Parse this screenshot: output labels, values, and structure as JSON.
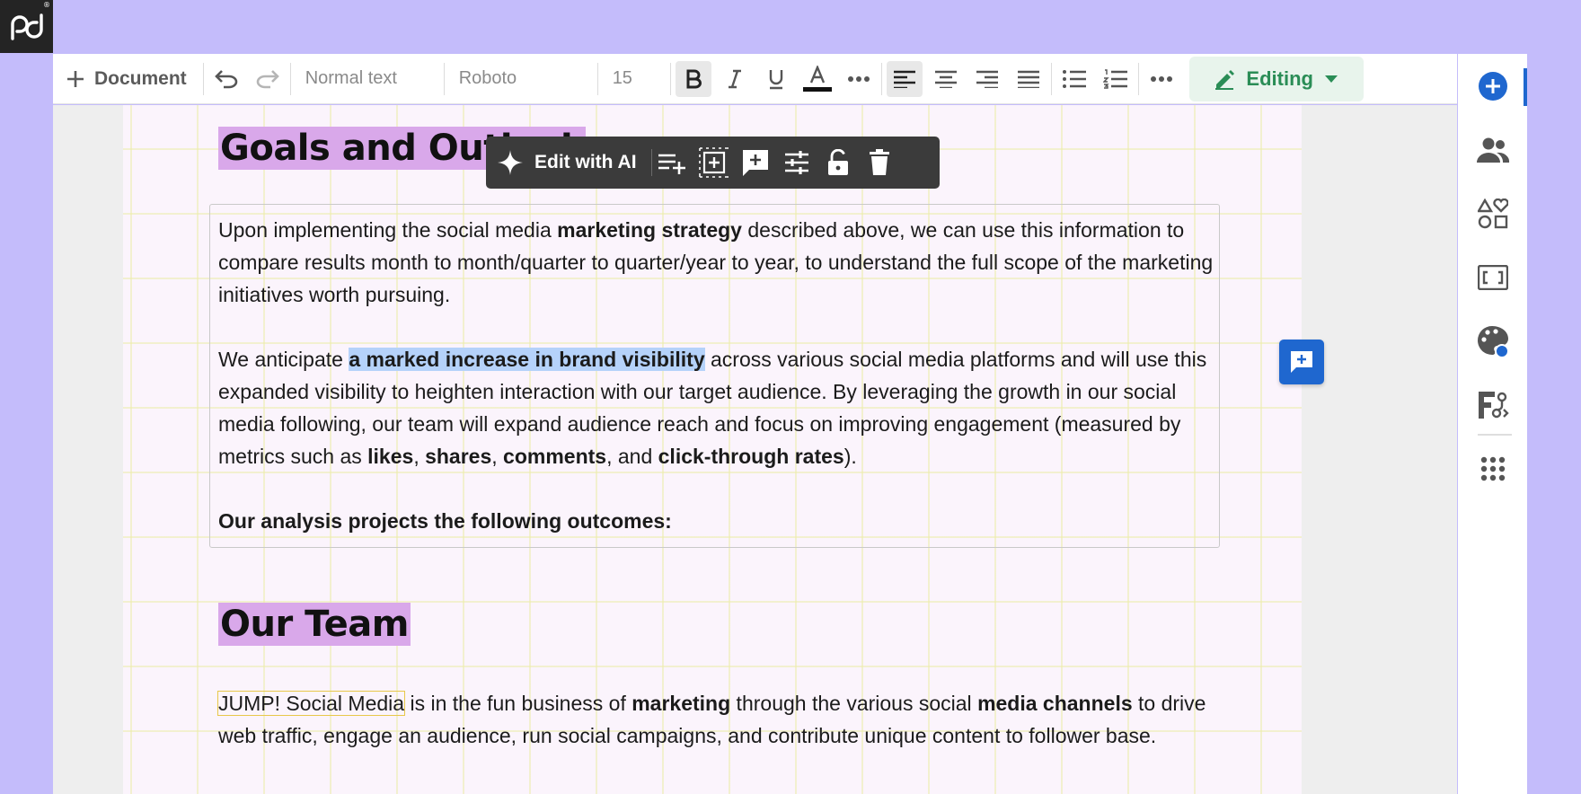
{
  "toolbar": {
    "document_label": "Document",
    "text_style": "Normal text",
    "font": "Roboto",
    "font_size": "15",
    "mode_label": "Editing"
  },
  "ai_toolbar": {
    "edit_with_ai_label": "Edit with AI"
  },
  "document": {
    "heading1": "Goals and Outlo",
    "heading1_hidden_tail": "ok",
    "p1": {
      "t1": "Upon implementing the social media ",
      "b1": "marketing strategy",
      "t2": " described above, we can use this information to compare results month to month/quarter to quarter/year to year, to understand the full scope of the marketing initiatives worth pursuing."
    },
    "p2": {
      "t1": "We anticipate ",
      "highlight": "a marked increase in brand visibility",
      "t2": " across various social media platforms and will use this expanded visibility to heighten interaction with our target audience. By leveraging the growth in our social media following, our team will expand audience reach and focus on improving engagement (measured by metrics such as ",
      "b1": "likes",
      "t3": ", ",
      "b2": "shares",
      "t4": ", ",
      "b3": "comments",
      "t5": ", and ",
      "b4": "click-through rates",
      "t6": ")."
    },
    "p3": "Our analysis projects the following outcomes:",
    "heading2": "Our Team",
    "p4": {
      "outlined": "JUMP! Social Media",
      "t1": " is in the fun business of ",
      "b1": "marketing",
      "t2": " through the various social ",
      "b2": "media channels",
      "t3": " to drive web traffic, engage an audience, run social campaigns, and contribute unique content to follower base."
    }
  },
  "colors": {
    "background": "#c4bcfb",
    "accent_blue": "#1f67cf",
    "editing_green": "#2a8d56",
    "heading_highlight": "#d9a8ea",
    "text_highlight": "#b5d2fa"
  }
}
